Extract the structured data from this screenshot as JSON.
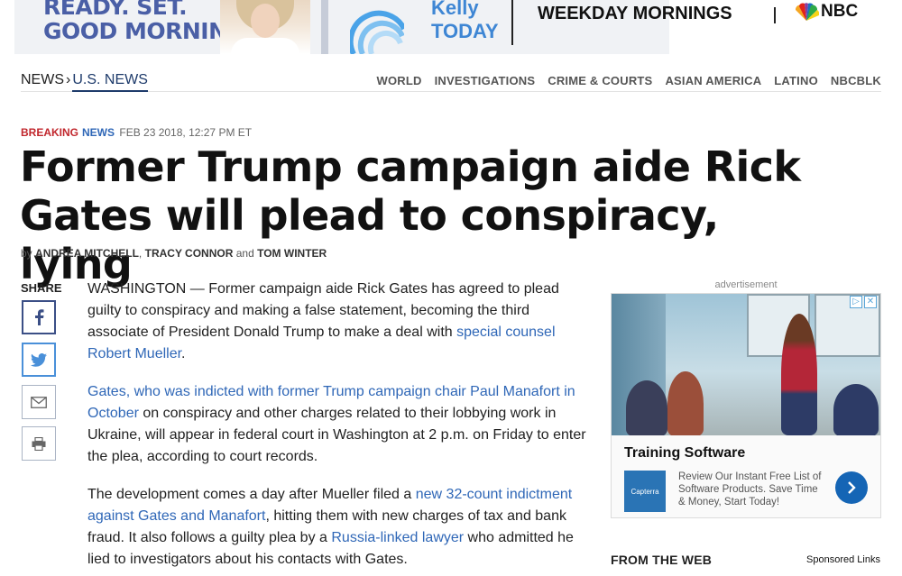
{
  "banner": {
    "line1": "READY. SET.",
    "line2": "GOOD MORNING.",
    "brand_top": "Kelly",
    "brand_bottom": "TODAY",
    "tagline": "WEEKDAY MORNINGS",
    "network": "NBC"
  },
  "nav": {
    "breadcrumb_root": "NEWS",
    "breadcrumb_current": "U.S. NEWS",
    "links": [
      "WORLD",
      "INVESTIGATIONS",
      "CRIME & COURTS",
      "ASIAN AMERICA",
      "LATINO",
      "NBCBLK"
    ]
  },
  "article": {
    "label_breaking": "Breaking",
    "label_news": "News",
    "date": "FEB 23 2018, 12:27 PM ET",
    "headline": "Former Trump campaign aide Rick Gates will plead to conspiracy, lying",
    "byline_prefix": "by",
    "authors": [
      "ANDREA MITCHELL",
      "TRACY CONNOR",
      "TOM WINTER"
    ],
    "byline_sep1": ",",
    "byline_and": "and",
    "paragraphs": [
      {
        "t1": "WASHINGTON — Former campaign aide Rick Gates has agreed to plead guilty to conspiracy and making a false statement, becoming the third associate of President Donald Trump to make a deal with ",
        "link": "special counsel Robert Mueller",
        "t2": "."
      },
      {
        "link": "Gates, who was indicted with former Trump campaign chair Paul Manafort in October",
        "t1": " on conspiracy and other charges related to their lobbying work in Ukraine, will appear in federal court in Washington at 2 p.m. on Friday to enter the plea, according to court records."
      },
      {
        "t1": "The development comes a day after Mueller filed a ",
        "link1": "new 32-count indictment against Gates and Manafort",
        "t2": ", hitting them with new charges of tax and bank fraud. It also follows a guilty plea by a ",
        "link2": "Russia-linked lawyer",
        "t3": " who admitted he lied to investigators about his contacts with Gates."
      }
    ]
  },
  "share": {
    "label": "SHARE",
    "buttons": [
      "facebook-icon",
      "twitter-icon",
      "email-icon",
      "print-icon"
    ]
  },
  "ad": {
    "label": "advertisement",
    "title": "Training Software",
    "logo_text": "Capterra",
    "description": "Review Our Instant Free List of Software Products. Save Time & Money, Start Today!"
  },
  "from_web": {
    "title": "FROM THE WEB",
    "sponsored": "Sponsored Links"
  },
  "colors": {
    "breaking": "#c1272d",
    "link": "#2f67b7",
    "nav_active": "#1e3b6b"
  }
}
